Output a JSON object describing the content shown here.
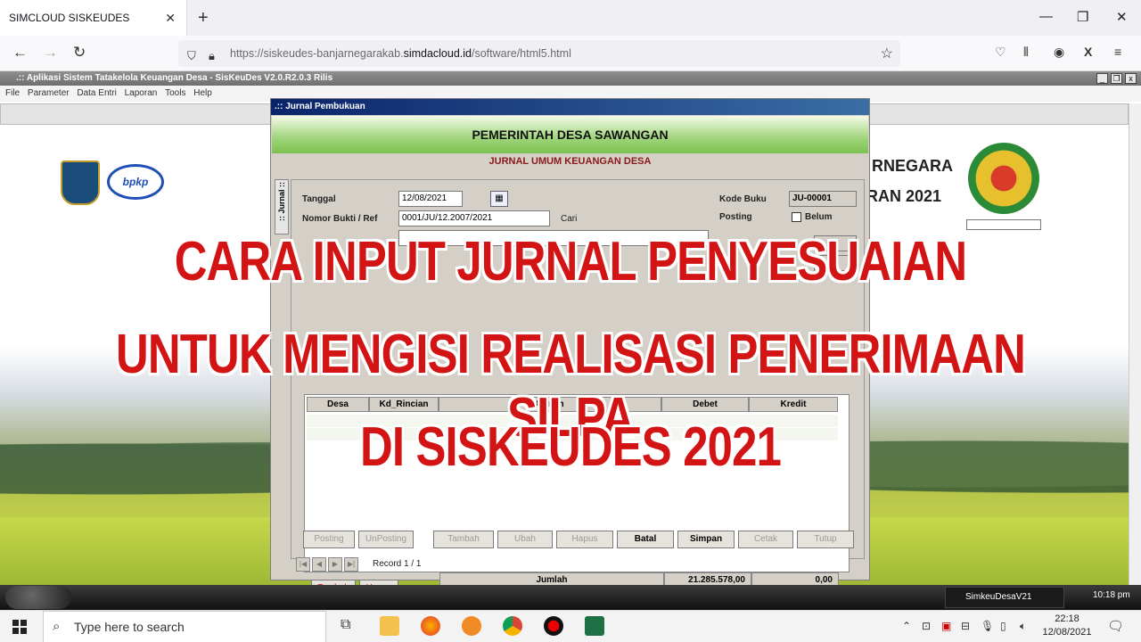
{
  "browser": {
    "tab_title": "SIMCLOUD SISKEUDES",
    "url_prefix": "https://siskeudes-banjarnegarakab.",
    "url_domain": "simdacloud.id",
    "url_path": "/software/html5.html"
  },
  "app": {
    "title": ".:: Aplikasi Sistem Tatakelola Keuangan Desa - SisKeuDes V2.0.R2.0.3 Rilis",
    "menu": [
      "File",
      "Parameter",
      "Data Entri",
      "Laporan",
      "Tools",
      "Help"
    ],
    "logo_text": "bpkp",
    "bg_text_1": "RNEGARA",
    "bg_text_2": "RAN 2021"
  },
  "dialog": {
    "title": ".:: Jurnal Pembukuan",
    "header": "PEMERINTAH DESA SAWANGAN",
    "subheader": "JURNAL UMUM KEUANGAN DESA",
    "side_tab": ":: Jurnal ::",
    "labels": {
      "tanggal": "Tanggal",
      "nomor_bukti": "Nomor Bukti / Ref",
      "cari": "Cari",
      "kode_buku": "Kode Buku",
      "posting": "Posting",
      "belum": "Belum"
    },
    "values": {
      "tanggal": "12/08/2021",
      "nomor_bukti": "0001/JU/12.2007/2021",
      "kode_buku": "JU-00001"
    },
    "grid_headers": [
      "Desa",
      "Kd_Rincian",
      "Uraian",
      "Debet",
      "Kredit"
    ],
    "grid_buttons": {
      "tambah": "Tambah",
      "hapus": "Hapus"
    },
    "totals": {
      "label": "Jumlah",
      "debet": "21.285.578,00",
      "kredit": "0,00"
    },
    "bottom_buttons": [
      "Posting",
      "UnPosting",
      "Tambah",
      "Ubah",
      "Hapus",
      "Batal",
      "Simpan",
      "Cetak",
      "Tutup"
    ],
    "record": "Record  1 / 1"
  },
  "overlay": {
    "line1": "CARA INPUT JURNAL PENYESUAIAN",
    "line2": "UNTUK MENGISI REALISASI PENERIMAAN SILPA",
    "line3": "DI SISKEUDES 2021"
  },
  "old_taskbar": {
    "app": "SimkeuDesaV21",
    "clock": "10:18 pm"
  },
  "taskbar": {
    "search_placeholder": "Type here to search",
    "time": "22:18",
    "date": "12/08/2021"
  }
}
